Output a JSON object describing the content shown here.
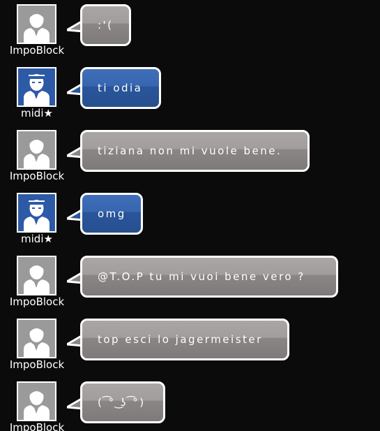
{
  "messages": [
    {
      "user": "ImpoBlock",
      "avatar": "gray-user-avatar",
      "text": ":'("
    },
    {
      "user": "midi★",
      "avatar": "blue-headband-avatar",
      "text": "ti odia"
    },
    {
      "user": "ImpoBlock",
      "avatar": "gray-user-avatar",
      "text": "tiziana non mi vuole bene."
    },
    {
      "user": "midi★",
      "avatar": "blue-headband-avatar",
      "text": "omg"
    },
    {
      "user": "ImpoBlock",
      "avatar": "gray-user-avatar",
      "text": "@T.O.P tu mi vuoi bene vero ?"
    },
    {
      "user": "ImpoBlock",
      "avatar": "gray-user-avatar",
      "text": "top esci lo jagermeister"
    },
    {
      "user": "ImpoBlock",
      "avatar": "gray-user-avatar",
      "text": "( ͡° ͜ʖ ͡°)"
    }
  ],
  "colors": {
    "background": "#0b0b0b",
    "gray_bubble": "#8b8686",
    "blue_bubble": "#2c5aa6",
    "border": "#ffffff"
  }
}
